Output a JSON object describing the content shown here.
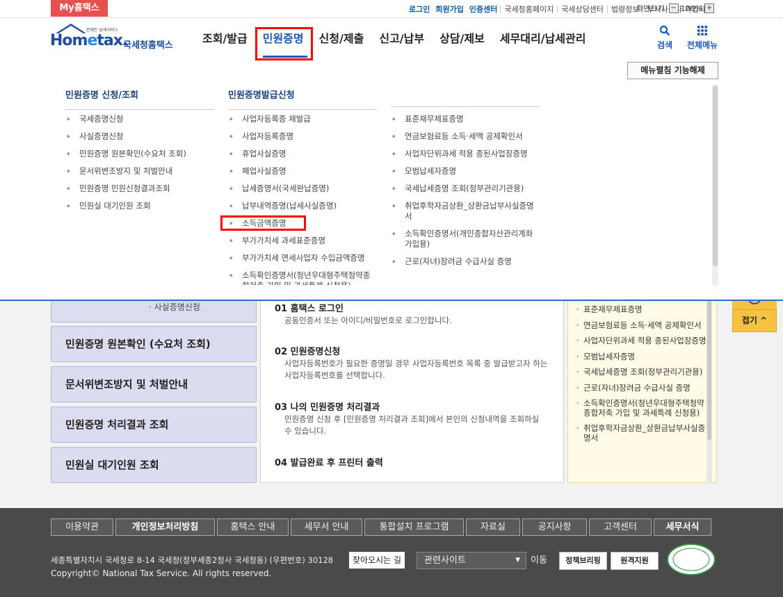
{
  "topbar": {
    "my_hometax": "My홈택스",
    "links": [
      "로그인",
      "회원가입",
      "인증센터",
      "국세청홈페이지",
      "국세상담센터",
      "법령정보",
      "부서사용자 가입하기"
    ],
    "zoom_label": "화면크기",
    "zoom_minus": "−",
    "zoom_value": "100%",
    "zoom_plus": "+"
  },
  "header": {
    "logo_tiny": "언제든 납세서비스",
    "logo_ho": "Hom",
    "logo_e": "e",
    "logo_tax": "tax.",
    "logo_nts": "국세청홈택스",
    "gnb": [
      "조회/발급",
      "민원증명",
      "신청/제출",
      "신고/납부",
      "상담/제보",
      "세무대리/납세관리"
    ],
    "search": "검색",
    "all_menu": "전체메뉴"
  },
  "mega": {
    "fold_off": "메뉴펼침 기능해제",
    "col1_title": "민원증명 신청/조회",
    "col1_items": [
      "국세증명신청",
      "사실증명신청",
      "민원증명 원본확인(수요처 조회)",
      "문서위변조방지 및 처벌안내",
      "민원증명 민원신청결과조회",
      "민원실 대기인원 조회"
    ],
    "col2_title": "민원증명발급신청",
    "col2_items": [
      "사업자등록증 재발급",
      "사업자등록증명",
      "휴업사실증명",
      "폐업사실증명",
      "납세증명서(국세완납증명)",
      "납부내역증명(납세사실증명)",
      "소득금액증명",
      "부가가치세 과세표준증명",
      "부가가치세 면세사업자 수입금액증명",
      "소득확인증명서(청년우대형주택청약종합저축 가입 및 과세특례 신청용)"
    ],
    "col3_items": [
      "표준재무제표증명",
      "연금보험료등 소득·세액 공제확인서",
      "사업자단위과세 적용 종된사업장증명",
      "모범납세자증명",
      "국세납세증명 조회(정부관리기관용)",
      "취업후학자금상환_상환금납부사실증명서",
      "소득확인증명서(개인종합자산관리계좌 가입용)",
      "근로(자녀)장려금 수급사실 증명"
    ]
  },
  "content": {
    "side_sub": "· 사실증명신청",
    "side_buttons": [
      "민원증명 원본확인 (수요처 조회)",
      "문서위변조방지 및 처벌안내",
      "민원증명 처리결과 조회",
      "민원실 대기인원 조회"
    ],
    "steps": [
      {
        "title": "01 홈택스 로그인",
        "desc": "공동인증서 또는 아이디/비밀번호로 로그인합니다."
      },
      {
        "title": "02 민원증명신청",
        "desc": "사업자등록번호가 필요한 증명일 경우 사업자등록번호 목록 중 발급받고자 하는 사업자등록번호를 선택합니다."
      },
      {
        "title": "03 나의 민원증명 처리결과",
        "desc": "민원증명 신청 후 [민원증명 처리결과 조회]에서 본인의 신청내역을 조회하실 수 있습니다."
      },
      {
        "title": "04 발급완료 후 프린터 출력",
        "desc": ""
      }
    ],
    "right_items": [
      "표준재무제표증명",
      "연금보험료등 소득·세액 공제확인서",
      "사업자단위과세 적용 종된사업장증명",
      "모범납세자증명",
      "국세납세증명 조회(정부관리기관용)",
      "근로(자녀)장려금 수급사실 증명",
      "소득확인증명서(청년우대형주택청약종합저축 가입 및 과세특례 신청용)",
      "취업후학자금상환_상환금납부사실증명서"
    ],
    "fold_btn": "접기 ^"
  },
  "footer": {
    "links": [
      "이용약관",
      "개인정보처리방침",
      "홈택스 안내",
      "세무서 안내",
      "통합설치 프로그램",
      "자료실",
      "공지사항",
      "고객센터",
      "세무서식"
    ],
    "address": "세종특별자치시 국세청로 8-14 국세청(정부세종2청사 국세청동) (우편번호) 30128",
    "find_btn": "찾아오시는 길",
    "copyright": "Copyright© National Tax Service. All rights reserved.",
    "related": "관련사이트",
    "go": "이동",
    "policy": "정책브리핑",
    "remote": "원격지원",
    "wa": "WA"
  },
  "colors": {
    "my_hometax_bg": "#e94f4f",
    "brand_blue": "#1b59b8",
    "highlight_red": "#ff0000",
    "side_button_bg": "#dcdcf0",
    "footer_bg": "#4a4a4a",
    "fold_btn_bg": "#f5c242"
  }
}
